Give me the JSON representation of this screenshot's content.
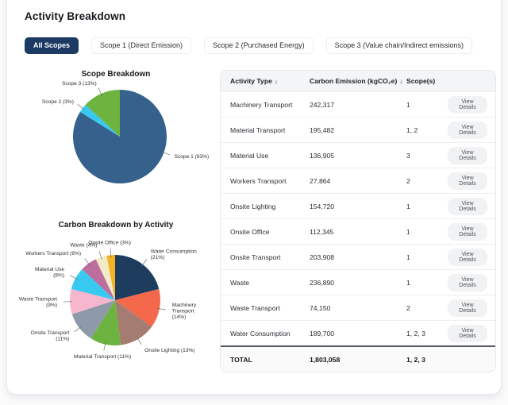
{
  "page": {
    "title": "Activity Breakdown"
  },
  "tabs": {
    "items": [
      {
        "label": "All Scopes",
        "active": true
      },
      {
        "label": "Scope 1 (Direct Emission)",
        "active": false
      },
      {
        "label": "Scope 2 (Purchased Energy)",
        "active": false
      },
      {
        "label": "Scope 3 (Value chain/Indirect emissions)",
        "active": false
      }
    ]
  },
  "colors": {
    "active_tab_bg": "#1d3a64",
    "card_bg": "#ffffff",
    "table_header_bg": "#f4f5f7",
    "leader_line": "#6b6f73"
  },
  "chart_data": [
    {
      "type": "pie",
      "title": "Scope Breakdown",
      "start_angle_deg": 0,
      "direction": "clockwise",
      "legend": "outside-labels",
      "slices": [
        {
          "name": "Scope 1",
          "pct": 83,
          "color": "#35618c",
          "label_lines": [
            "Scope 1 (83%)"
          ],
          "label_angle_deg": 110
        },
        {
          "name": "Scope 2",
          "pct": 3,
          "color": "#38c9f1",
          "label_lines": [
            "Scope 2 (3%)"
          ]
        },
        {
          "name": "Scope 3",
          "pct": 13,
          "color": "#6db33f",
          "label_lines": [
            "Scope 3 (13%)"
          ]
        }
      ]
    },
    {
      "type": "pie",
      "title": "Carbon Breakdown by Activity",
      "start_angle_deg": 0,
      "direction": "clockwise",
      "legend": "outside-labels",
      "slices": [
        {
          "name": "Water Consumption",
          "pct": 21,
          "color": "#1d3c5e",
          "label_lines": [
            "Water Consumption",
            "(21%)"
          ]
        },
        {
          "name": "Machinery Transport",
          "pct": 14,
          "color": "#f4694c",
          "label_lines": [
            "Machinery",
            "Transport",
            "(14%)"
          ]
        },
        {
          "name": "Onsite Lighting",
          "pct": 13,
          "color": "#a47c72",
          "label_lines": [
            "Onsite Lighting (13%)"
          ]
        },
        {
          "name": "Material Transport",
          "pct": 11,
          "color": "#6db33f",
          "label_lines": [
            "Material Transport (11%)"
          ]
        },
        {
          "name": "Onsite Transport",
          "pct": 11,
          "color": "#8e9aa9",
          "label_lines": [
            "Onsite Transport",
            "(11%)"
          ]
        },
        {
          "name": "Waste Transport",
          "pct": 9,
          "color": "#f6b6ce",
          "label_lines": [
            "Waste Transport",
            "(9%)"
          ]
        },
        {
          "name": "Material Use",
          "pct": 8,
          "color": "#38c9f1",
          "label_lines": [
            "Material Use",
            "(8%)"
          ]
        },
        {
          "name": "Workers Transport",
          "pct": 6,
          "color": "#bd6e9e",
          "label_lines": [
            "Workers Transport (6%)"
          ]
        },
        {
          "name": "Waste",
          "pct": 4,
          "color": "#f2ebc8",
          "label_lines": [
            "Waste (4%)"
          ]
        },
        {
          "name": "Onsite Office",
          "pct": 3,
          "color": "#f4b324",
          "label_lines": [
            "Onsite Office (3%)"
          ]
        }
      ]
    }
  ],
  "table": {
    "columns": [
      {
        "label": "Activity Type",
        "sortable": true
      },
      {
        "label": "Carbon Emission (kgCO₂e)",
        "sortable": true
      },
      {
        "label": "Scope(s)",
        "sortable": false
      }
    ],
    "sort_icon": "↓",
    "view_details_label": "View Details",
    "rows": [
      {
        "activity": "Machinery Transport",
        "emission": "242,317",
        "scopes": "1"
      },
      {
        "activity": "Material Transport",
        "emission": "195,482",
        "scopes": "1, 2"
      },
      {
        "activity": "Material Use",
        "emission": "136,905",
        "scopes": "3"
      },
      {
        "activity": "Workers Transport",
        "emission": "27,864",
        "scopes": "2"
      },
      {
        "activity": "Onsite Lighting",
        "emission": "154,720",
        "scopes": "1"
      },
      {
        "activity": "Onsite Office",
        "emission": "112,345",
        "scopes": "1"
      },
      {
        "activity": "Onsite Transport",
        "emission": "203,908",
        "scopes": "1"
      },
      {
        "activity": "Waste",
        "emission": "236,890",
        "scopes": "1"
      },
      {
        "activity": "Waste Transport",
        "emission": "74,150",
        "scopes": "2"
      },
      {
        "activity": "Water Consumption",
        "emission": "189,700",
        "scopes": "1, 2, 3"
      }
    ],
    "total": {
      "label": "TOTAL",
      "value": "1,803,058",
      "scopes": "1, 2, 3"
    }
  }
}
